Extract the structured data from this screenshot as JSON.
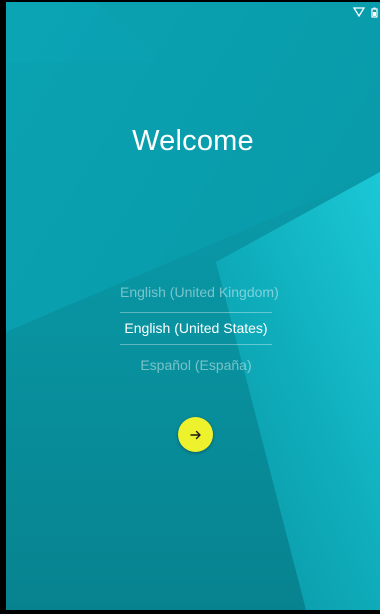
{
  "welcome": {
    "title": "Welcome"
  },
  "languages": {
    "items": [
      {
        "label": "English (United Kingdom)",
        "selected": false
      },
      {
        "label": "English (United States)",
        "selected": true
      },
      {
        "label": "Español (España)",
        "selected": false
      }
    ]
  },
  "next_button": {
    "icon": "arrow-right-icon"
  },
  "status_bar": {
    "icons": [
      "wifi-icon",
      "battery-icon"
    ]
  },
  "colors": {
    "background": "#0a8f9e",
    "accent_light": "#14c3d2",
    "button": "#eef22d",
    "text": "#ffffff"
  }
}
